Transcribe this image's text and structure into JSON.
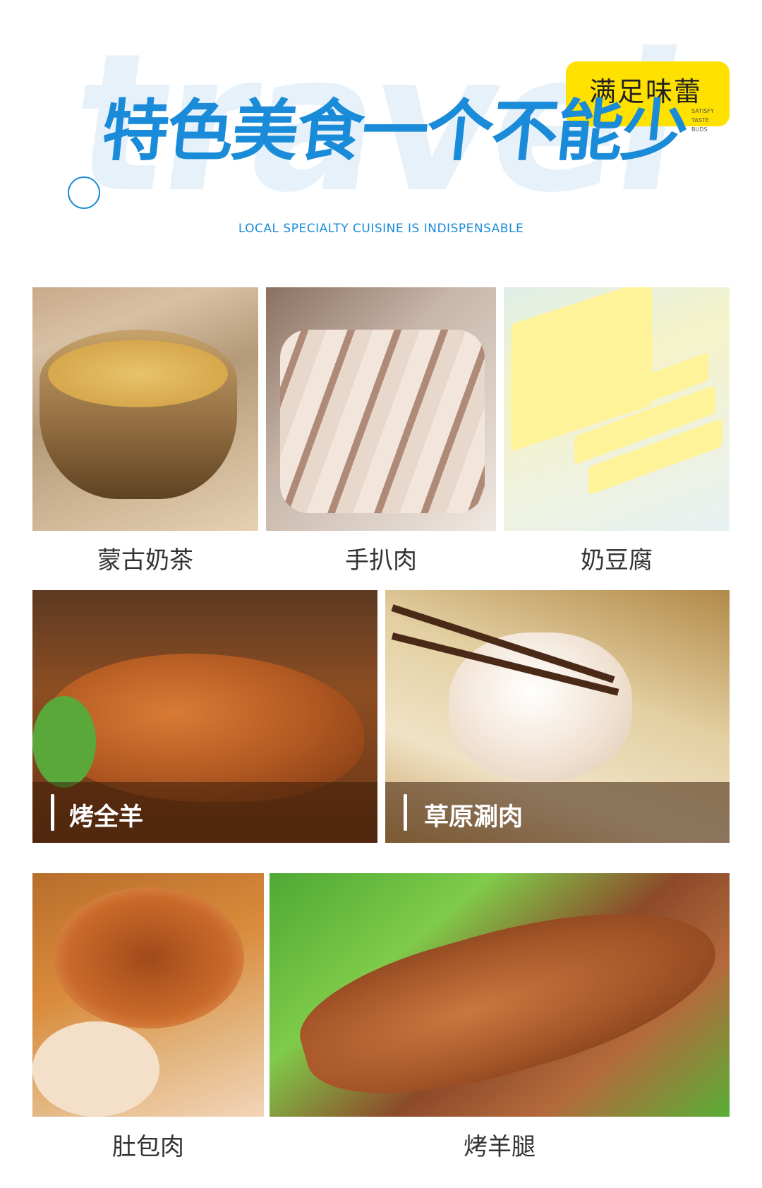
{
  "header": {
    "bg_word": "travel",
    "title": "特色美食一个不能少",
    "badge": {
      "text": "满足味蕾",
      "sub": [
        "SATISFY",
        "TASTE",
        "BUDS"
      ]
    },
    "subtitle": "LOCAL SPECIALTY CUISINE IS INDISPENSABLE"
  },
  "row1": [
    {
      "label": "蒙古奶茶"
    },
    {
      "label": "手扒肉"
    },
    {
      "label": "奶豆腐"
    }
  ],
  "row2": [
    {
      "label": "烤全羊"
    },
    {
      "label": "草原涮肉"
    }
  ],
  "row3": [
    {
      "label": "肚包肉"
    },
    {
      "label": "烤羊腿"
    }
  ],
  "colors": {
    "accent": "#1a8bd8",
    "badge": "#ffe100"
  }
}
